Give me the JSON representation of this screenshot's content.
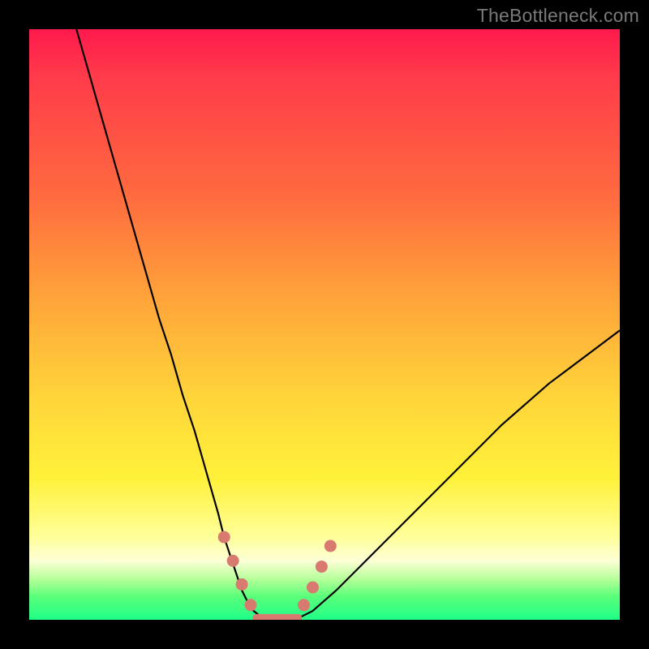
{
  "watermark": "TheBottleneck.com",
  "colors": {
    "frame": "#000000",
    "curve": "#000000",
    "marker_fill": "#d97a70",
    "gradient_stops": [
      "#ff1a4d",
      "#ff3b4a",
      "#ff6a3f",
      "#ffa23a",
      "#ffd43a",
      "#fff13a",
      "#ffff9a",
      "#fdffd6",
      "#b8ff9a",
      "#5bff7a",
      "#1fff87"
    ]
  },
  "chart_data": {
    "type": "line",
    "title": "",
    "xlabel": "",
    "ylabel": "",
    "xlim": [
      0,
      100
    ],
    "ylim": [
      0,
      100
    ],
    "grid": false,
    "legend": false,
    "series": [
      {
        "name": "bottleneck-curve",
        "x": [
          8,
          10,
          12,
          14,
          16,
          18,
          20,
          22,
          24,
          26,
          28,
          30,
          32,
          33,
          34,
          35,
          36,
          37,
          38,
          39,
          40,
          42,
          44,
          46,
          48,
          52,
          56,
          60,
          64,
          68,
          72,
          76,
          80,
          84,
          88,
          92,
          96,
          100
        ],
        "y": [
          100,
          93,
          86,
          79,
          72,
          65,
          58,
          51,
          45,
          38,
          32,
          25,
          18,
          14,
          11,
          8,
          5,
          3,
          1.5,
          0.7,
          0.3,
          0.2,
          0.2,
          0.5,
          1.5,
          5,
          9,
          13,
          17,
          21,
          25,
          29,
          33,
          36.5,
          40,
          43,
          46,
          49
        ]
      }
    ],
    "markers": [
      {
        "x": 33.0,
        "y": 14.0
      },
      {
        "x": 34.5,
        "y": 10.0
      },
      {
        "x": 36.0,
        "y": 6.0
      },
      {
        "x": 37.5,
        "y": 2.5
      },
      {
        "x": 46.5,
        "y": 2.5
      },
      {
        "x": 48.0,
        "y": 5.5
      },
      {
        "x": 49.5,
        "y": 9.0
      },
      {
        "x": 51.0,
        "y": 12.5
      }
    ],
    "flat_segment": {
      "x0": 38.5,
      "x1": 45.5,
      "y": 0.3,
      "thickness_px": 10
    }
  }
}
